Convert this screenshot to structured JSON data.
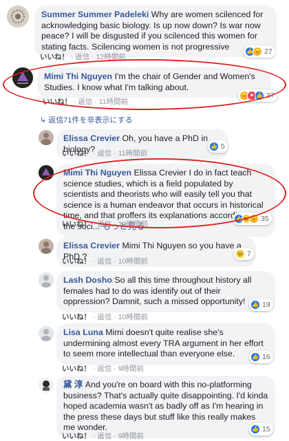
{
  "comments": [
    {
      "name": "Summer Summer Padeleki",
      "text": "Why are women scilenced for acknowledging basic biology. Is up now down? Is war now peace? I will be disgusted if you scilenced this women for stating facts. Scilencing women is not progressive",
      "like_label": "いいね！",
      "reply_label": "返信",
      "time": "12時間前",
      "reaction_count": "27"
    },
    {
      "name": "Mimi Thi Nguyen",
      "text": "I'm the chair of Gender and Women's Studies. I know what I'm talking about.",
      "like_label": "いいね！",
      "reply_label": "返信",
      "time": "11時間前",
      "reaction_count": "37"
    }
  ],
  "hidden_replies_label": "返信71件を非表示にする",
  "replies": [
    {
      "name": "Elissa Crevier",
      "text": "Oh, you have a PhD in biology?",
      "like_label": "いいね！",
      "reply_label": "返信",
      "time": "11時間前",
      "reaction_count": "5"
    },
    {
      "name": "Mimi Thi Nguyen",
      "text": "Elissa Crevier I do in fact teach science studies, which is a field populated by scientists and theorists who will easily tell you that science is a human endeavor that occurs in historical time, and that proffers its explanations according to the soci...",
      "see_more": "もっと見る",
      "like_label": "いいね！",
      "reply_label": "返信",
      "time": "10時間前",
      "reaction_count": "35"
    },
    {
      "name": "Elissa Crevier",
      "text": "Mimi Thi Nguyen so you have a PhD ?",
      "like_label": "いいね！",
      "reply_label": "返信",
      "time": "10時間前",
      "reaction_count": "7"
    },
    {
      "name": "Lash Dosho",
      "text": "So all this time throughout history all females had to do was identify out of their oppression? Damnit, such a missed opportunity!",
      "like_label": "いいね！",
      "reply_label": "返信",
      "time": "10時間前",
      "reaction_count": "19"
    },
    {
      "name": "Lisa Luna",
      "text": "Mimi doesn't quite realise she's undermining almost every TRA argument in her effort to seem more intellectual than everyone else.",
      "like_label": "いいね！",
      "reply_label": "返信",
      "time": "9時間前",
      "reaction_count": "16"
    },
    {
      "name": "黛 淳",
      "text": "And you're on board with this no-platforming business? That's actually quite disappointing. I'd kinda hoped academia wasn't as badly off as I'm hearing in the press these days but stuff like this really makes me wonder.",
      "like_label": "いいね！",
      "reply_label": "返信",
      "time": "9時間前",
      "reaction_count": "15"
    }
  ],
  "colors": {
    "name": "#385898",
    "bubble": "#f2f3f5",
    "highlight_ring": "#e02020",
    "like_blue": "#1877f2"
  }
}
